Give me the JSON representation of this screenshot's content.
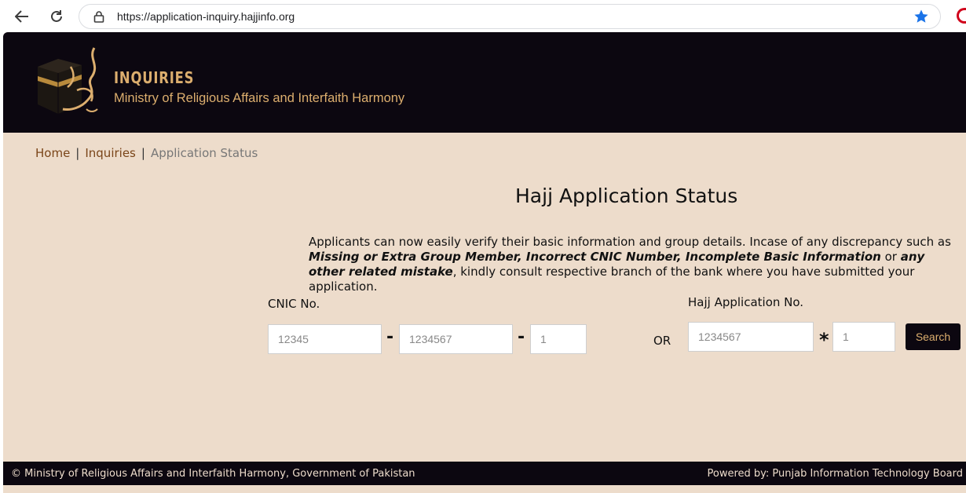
{
  "browser": {
    "url": "https://application-inquiry.hajjinfo.org"
  },
  "header": {
    "brand": "INQUIRIES",
    "subtitle": "Ministry of Religious Affairs and Interfaith Harmony"
  },
  "breadcrumb": {
    "home": "Home",
    "sep": "|",
    "inquiries": "Inquiries",
    "current": "Application Status"
  },
  "main": {
    "title": "Hajj Application Status",
    "desc_1": "Applicants can now easily verify their basic information and group details. Incase of any discrepancy such as ",
    "desc_bold_1": "Missing or Extra Group Member, Incorrect CNIC Number, Incomplete Basic Information",
    "desc_2": " or ",
    "desc_bold_2": "any other related mistake",
    "desc_3": ", kindly consult respective branch of the bank where you have submitted your application."
  },
  "cnic": {
    "label": "CNIC No.",
    "part1_placeholder": "12345",
    "part2_placeholder": "1234567",
    "part3_placeholder": "1",
    "dash": "-"
  },
  "or_label": "OR",
  "application": {
    "label": "Hajj Application No.",
    "number_placeholder": "1234567",
    "suffix_placeholder": "1",
    "separator": "*"
  },
  "search_button": "Search",
  "footer": {
    "left": "© Ministry of Religious Affairs and Interfaith Harmony, Government of Pakistan",
    "right": "Powered by: Punjab Information Technology Board"
  },
  "colors": {
    "header_bg": "#0c0710",
    "gold": "#dcae6e",
    "page_bg": "#eddccb",
    "link": "#7a4519",
    "star": "#1a73e8"
  }
}
